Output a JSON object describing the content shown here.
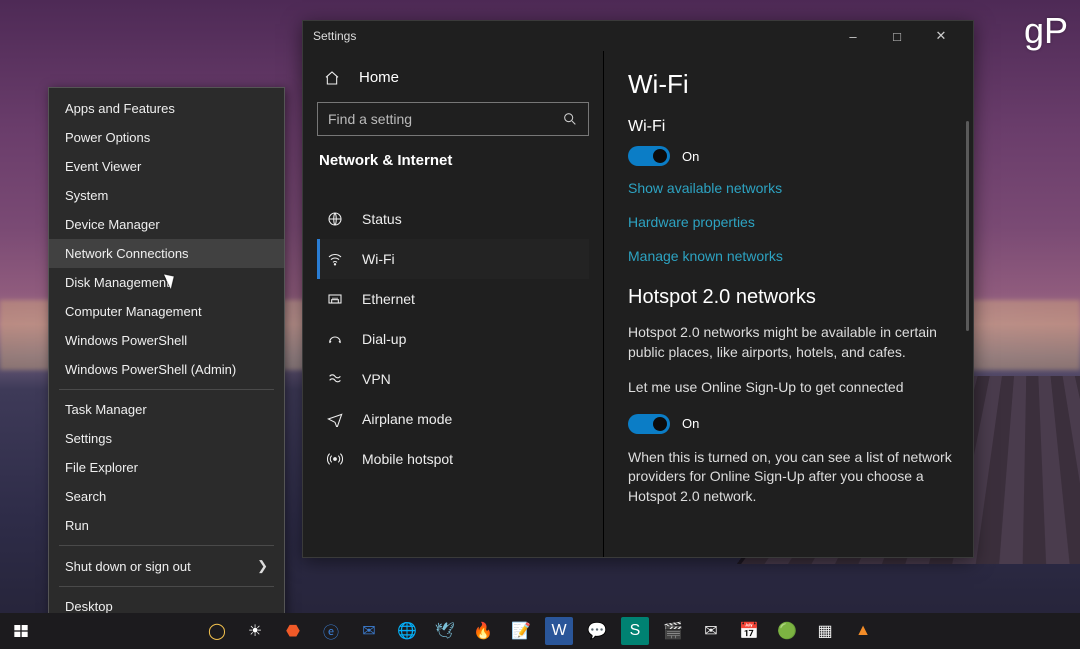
{
  "watermark": "gP",
  "winx": {
    "sections": [
      [
        "Apps and Features",
        "Power Options",
        "Event Viewer",
        "System",
        "Device Manager",
        "Network Connections",
        "Disk Management",
        "Computer Management",
        "Windows PowerShell",
        "Windows PowerShell (Admin)"
      ],
      [
        "Task Manager",
        "Settings",
        "File Explorer",
        "Search",
        "Run"
      ],
      [
        "Shut down or sign out"
      ],
      [
        "Desktop"
      ]
    ],
    "hovered": "Network Connections",
    "chevron_on": "Shut down or sign out"
  },
  "settings": {
    "window_title": "Settings",
    "home_label": "Home",
    "search_placeholder": "Find a setting",
    "section_heading": "Network & Internet",
    "nav_items": [
      {
        "icon": "status",
        "label": "Status"
      },
      {
        "icon": "wifi",
        "label": "Wi-Fi",
        "selected": true
      },
      {
        "icon": "ethernet",
        "label": "Ethernet"
      },
      {
        "icon": "dialup",
        "label": "Dial-up"
      },
      {
        "icon": "vpn",
        "label": "VPN"
      },
      {
        "icon": "airplane",
        "label": "Airplane mode"
      },
      {
        "icon": "hotspot",
        "label": "Mobile hotspot"
      }
    ],
    "content": {
      "page_title": "Wi-Fi",
      "wifi_label": "Wi-Fi",
      "wifi_state": "On",
      "links": [
        "Show available networks",
        "Hardware properties",
        "Manage known networks"
      ],
      "hotspot_heading": "Hotspot 2.0 networks",
      "hotspot_desc": "Hotspot 2.0 networks might be available in certain public places, like airports, hotels, and cafes.",
      "signup_label": "Let me use Online Sign-Up to get connected",
      "signup_state": "On",
      "signup_desc": "When this is turned on, you can see a list of network providers for Online Sign-Up after you choose a Hotspot 2.0 network."
    }
  },
  "taskbar": {
    "icons": [
      {
        "name": "chrome",
        "glyph": "◯",
        "color": "#f2c14e",
        "bg": ""
      },
      {
        "name": "sun",
        "glyph": "☀",
        "color": "#fff"
      },
      {
        "name": "brave",
        "glyph": "⬣",
        "color": "#f05a28"
      },
      {
        "name": "edge",
        "glyph": "ⓔ",
        "color": "#3c7dd1"
      },
      {
        "name": "thunderbird",
        "glyph": "✉",
        "color": "#3c7dd1"
      },
      {
        "name": "firefox",
        "glyph": "🌐",
        "color": "#f28c28"
      },
      {
        "name": "dove",
        "glyph": "🕊",
        "color": "#7cc0d8"
      },
      {
        "name": "burn",
        "glyph": "🔥",
        "color": "#e6a23c"
      },
      {
        "name": "notes",
        "glyph": "📝",
        "color": "#7cc0d8"
      },
      {
        "name": "word",
        "glyph": "W",
        "color": "#fff",
        "bg": "#2a5699"
      },
      {
        "name": "teams",
        "glyph": "💬",
        "color": "#5059c9"
      },
      {
        "name": "sway",
        "glyph": "S",
        "color": "#fff",
        "bg": "#008272"
      },
      {
        "name": "videos",
        "glyph": "🎬",
        "color": "#eee"
      },
      {
        "name": "mail",
        "glyph": "✉",
        "color": "#eee"
      },
      {
        "name": "calendar",
        "glyph": "📅",
        "color": "#eee"
      },
      {
        "name": "frog",
        "glyph": "🟢",
        "color": "#3c3"
      },
      {
        "name": "calculator",
        "glyph": "▦",
        "color": "#eee"
      },
      {
        "name": "vlc",
        "glyph": "▲",
        "color": "#f28c28"
      }
    ]
  }
}
